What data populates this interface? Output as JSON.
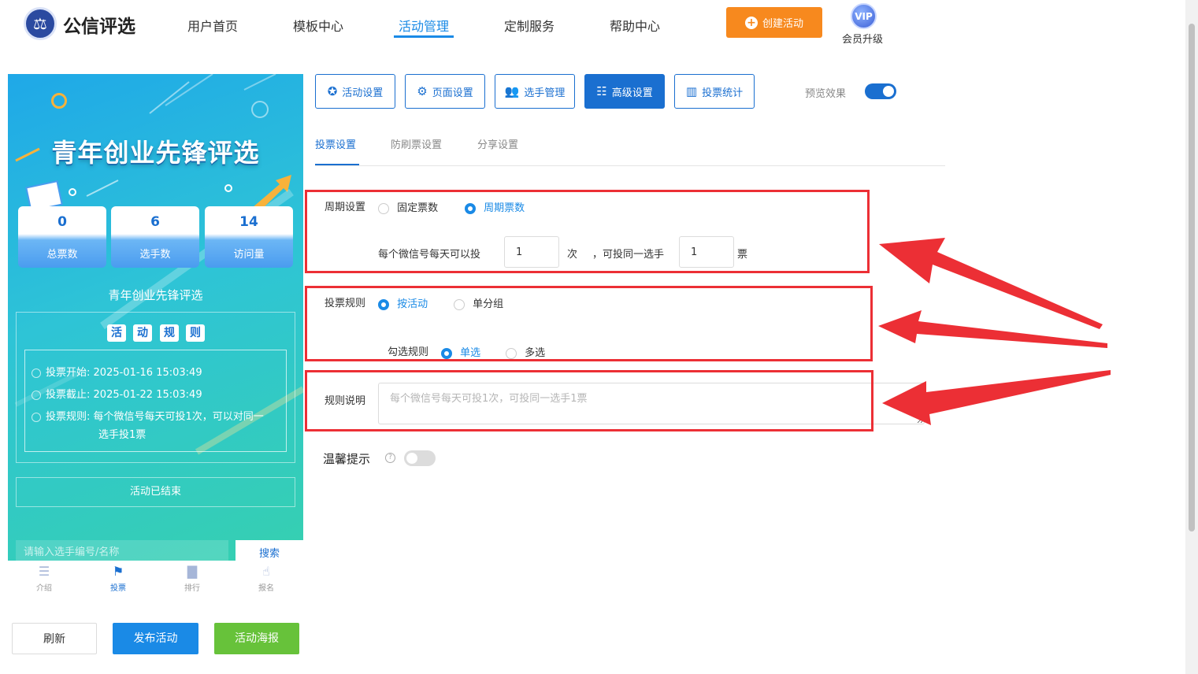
{
  "header": {
    "logo_text": "公信评选",
    "nav": [
      "用户首页",
      "模板中心",
      "活动管理",
      "定制服务",
      "帮助中心"
    ],
    "active_nav": "活动管理",
    "create_label": "创建活动",
    "vip_badge": "VIP",
    "vip_label": "会员升级"
  },
  "preview": {
    "banner_title": "青年创业先锋评选",
    "stats": [
      {
        "value": "0",
        "label": "总票数"
      },
      {
        "value": "6",
        "label": "选手数"
      },
      {
        "value": "14",
        "label": "访问量"
      }
    ],
    "subtitle": "青年创业先锋评选",
    "rules_heading": [
      "活",
      "动",
      "规",
      "则"
    ],
    "rules": [
      {
        "label": "投票开始:",
        "value": "2025-01-16 15:03:49"
      },
      {
        "label": "投票截止:",
        "value": "2025-01-22 15:03:49"
      },
      {
        "label": "投票规则:",
        "value": "每个微信号每天可投1次，可以对同一",
        "value2": "选手投1票"
      }
    ],
    "ended": "活动已结束",
    "search_placeholder": "请输入选手编号/名称",
    "search_label": "搜索",
    "tabs": [
      {
        "label": "介绍",
        "icon": "list-icon"
      },
      {
        "label": "投票",
        "icon": "flag-icon"
      },
      {
        "label": "排行",
        "icon": "bar-chart-icon"
      },
      {
        "label": "报名",
        "icon": "hand-icon"
      }
    ],
    "active_tab": "投票"
  },
  "bottom_buttons": {
    "refresh": "刷新",
    "publish": "发布活动",
    "poster": "活动海报"
  },
  "toolbar": {
    "buttons": [
      {
        "label": "活动设置",
        "icon": "star-icon"
      },
      {
        "label": "页面设置",
        "icon": "gear-icon"
      },
      {
        "label": "选手管理",
        "icon": "users-icon"
      },
      {
        "label": "高级设置",
        "icon": "sliders-icon"
      },
      {
        "label": "投票统计",
        "icon": "stats-icon"
      }
    ],
    "active": "高级设置",
    "preview_label": "预览效果",
    "preview_on": true
  },
  "subtabs": {
    "items": [
      "投票设置",
      "防刷票设置",
      "分享设置"
    ],
    "active": "投票设置"
  },
  "form": {
    "cycle": {
      "label": "周期设置",
      "options": [
        "固定票数",
        "周期票数"
      ],
      "selected": "周期票数",
      "per_day_prefix": "每个微信号每天可以投",
      "times_value": "1",
      "times_unit": "次",
      "same_prefix": "，可投同一选手",
      "votes_value": "1",
      "votes_unit": "票"
    },
    "rule": {
      "label": "投票规则",
      "options": [
        "按活动",
        "单分组"
      ],
      "selected": "按活动",
      "check_label": "勾选规则",
      "check_options": [
        "单选",
        "多选"
      ],
      "check_selected": "单选"
    },
    "desc": {
      "label": "规则说明",
      "placeholder": "每个微信号每天可投1次，可投同一选手1票"
    },
    "tip": {
      "label": "温馨提示",
      "enabled": false
    }
  },
  "colors": {
    "primary": "#1a6fd0",
    "accent": "#1a8ae6",
    "orange": "#f7891e",
    "green": "#67c23a",
    "annotation_red": "#ec2f35"
  }
}
